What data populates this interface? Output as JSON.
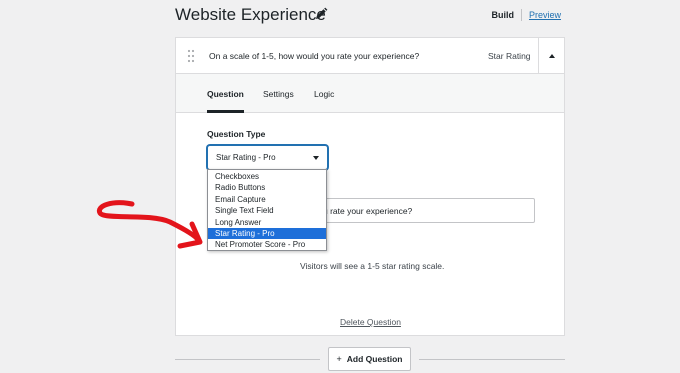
{
  "header": {
    "title": "Website Experience",
    "build_label": "Build",
    "preview_label": "Preview"
  },
  "question_card": {
    "summary": "On a scale of 1-5, how would you rate your experience?",
    "type_label": "Star Rating",
    "tabs": [
      {
        "label": "Question",
        "active": true
      },
      {
        "label": "Settings",
        "active": false
      },
      {
        "label": "Logic",
        "active": false
      }
    ],
    "question_type_label": "Question Type",
    "selected_type": "Star Rating - Pro",
    "question_text_visible": "you rate your experience?",
    "hint": "Visitors will see a 1-5 star rating scale.",
    "delete_label": "Delete Question"
  },
  "dropdown": {
    "options": [
      "Checkboxes",
      "Radio Buttons",
      "Email Capture",
      "Single Text Field",
      "Long Answer",
      "Star Rating - Pro",
      "Net Promoter Score - Pro"
    ],
    "selected_index": 5
  },
  "footer": {
    "add_question_label": "Add Question",
    "add_icon": "+"
  },
  "colors": {
    "accent": "#2271b1",
    "selected_option": "#1e6fd9",
    "annotation_arrow": "#e3141b"
  }
}
